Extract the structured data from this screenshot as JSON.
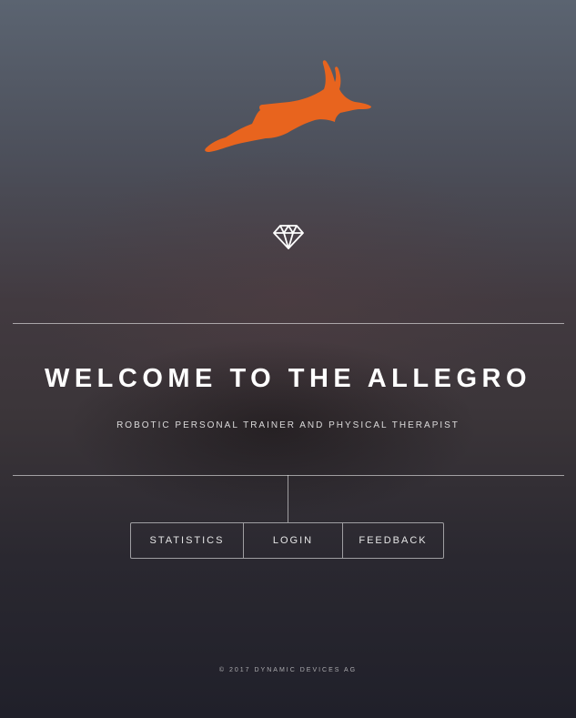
{
  "logo": {
    "icon": "hare-icon",
    "color": "#e8641e"
  },
  "emblem": {
    "icon": "diamond-icon"
  },
  "hero": {
    "title": "WELCOME TO THE ALLEGRO",
    "subtitle": "ROBOTIC PERSONAL TRAINER AND PHYSICAL THERAPIST"
  },
  "nav": {
    "statistics": "STATISTICS",
    "login": "LOGIN",
    "feedback": "FEEDBACK"
  },
  "footer": {
    "copyright": "© 2017 DYNAMIC DEVICES AG"
  }
}
